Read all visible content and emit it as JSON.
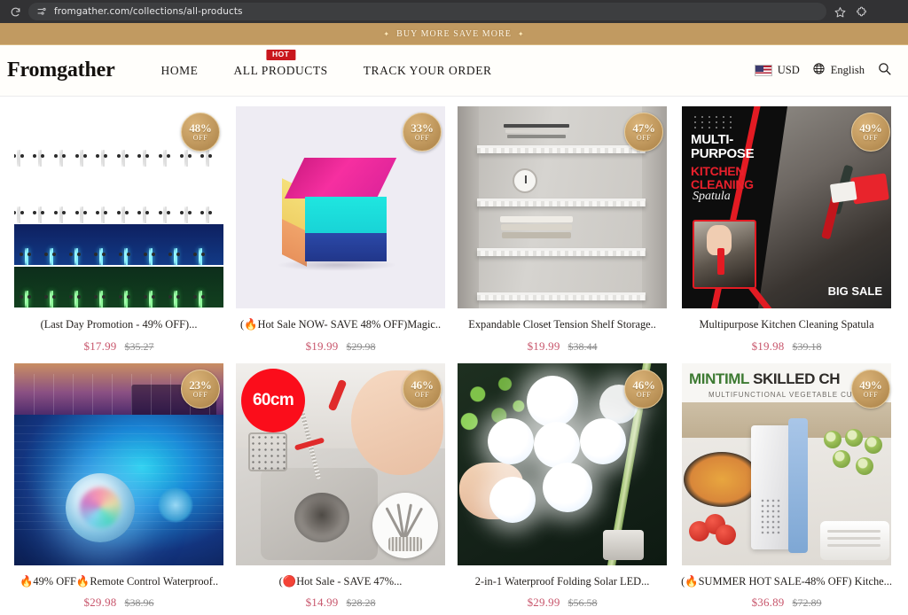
{
  "browser": {
    "url": "fromgather.com/collections/all-products",
    "reload_icon": "reload-icon",
    "site_settings_icon": "site-settings-icon",
    "bookmark_icon": "star-icon",
    "extensions_icon": "extensions-icon"
  },
  "announcement": {
    "text": "BUY MORE SAVE MORE",
    "left_sparkle": "✦",
    "right_sparkle": "✦",
    "background": "#c19a61"
  },
  "header": {
    "brand": "Fromgather",
    "nav": [
      {
        "label": "HOME",
        "badge": null
      },
      {
        "label": "ALL PRODUCTS",
        "badge": "HOT"
      },
      {
        "label": "TRACK YOUR ORDER",
        "badge": null
      }
    ],
    "currency": "USD",
    "currency_flag": "us-flag-icon",
    "language": "English",
    "globe_icon": "globe-icon",
    "search_icon": "search-icon"
  },
  "products": [
    {
      "title": "(Last Day Promotion - 49% OFF)...",
      "sale_price": "$17.99",
      "compare_price": "$35.27",
      "discount": "48%",
      "discount_off": "OFF"
    },
    {
      "title": "(🔥Hot Sale NOW- SAVE 48% OFF)Magic..",
      "sale_price": "$19.99",
      "compare_price": "$29.98",
      "discount": "33%",
      "discount_off": "OFF"
    },
    {
      "title": "Expandable Closet Tension Shelf Storage..",
      "sale_price": "$19.99",
      "compare_price": "$38.44",
      "discount": "47%",
      "discount_off": "OFF"
    },
    {
      "title": "Multipurpose Kitchen Cleaning Spatula",
      "sale_price": "$19.98",
      "compare_price": "$39.18",
      "discount": "49%",
      "discount_off": "OFF",
      "image_text": {
        "line1": "MULTI-",
        "line2": "PURPOSE",
        "line3": "KITCHEN",
        "line4": "CLEANING",
        "script": "Spatula",
        "corner": "BIG SALE"
      }
    },
    {
      "title": "🔥49% OFF🔥Remote Control Waterproof..",
      "sale_price": "$29.98",
      "compare_price": "$38.96",
      "discount": "23%",
      "discount_off": "OFF"
    },
    {
      "title": "(🔴Hot Sale - SAVE 47%...",
      "sale_price": "$14.99",
      "compare_price": "$28.28",
      "discount": "46%",
      "discount_off": "OFF",
      "image_text": {
        "badge": "60cm"
      }
    },
    {
      "title": "2-in-1 Waterproof Folding Solar LED...",
      "sale_price": "$29.99",
      "compare_price": "$56.58",
      "discount": "46%",
      "discount_off": "OFF"
    },
    {
      "title": "(🔥SUMMER HOT SALE-48% OFF) Kitche...",
      "sale_price": "$36.89",
      "compare_price": "$72.89",
      "discount": "49%",
      "discount_off": "OFF",
      "image_text": {
        "brand": "MINTIML",
        "headline": "SKILLED CH",
        "sub": "MULTIFUNCTIONAL VEGETABLE CUTTER"
      }
    }
  ],
  "colors": {
    "sale_price": "#c8566c",
    "compare_price": "#8c8c8c",
    "badge_gold": "#c29a5f",
    "hot_red": "#c9161d"
  }
}
